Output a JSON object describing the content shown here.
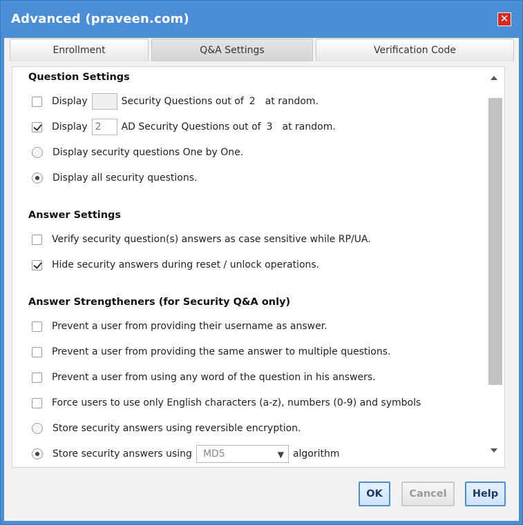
{
  "dialog": {
    "title": "Advanced (praveen.com)",
    "close_glyph": "✕"
  },
  "tabs": [
    {
      "label": "Enrollment",
      "active": false
    },
    {
      "label": "Q&A Settings",
      "active": true
    },
    {
      "label": "Verification Code",
      "active": false
    }
  ],
  "question_settings": {
    "title": "Question Settings",
    "row1": {
      "checked": false,
      "pre": "Display",
      "value": "",
      "mid": "Security Questions out of",
      "count": "2",
      "post": "at random."
    },
    "row2": {
      "checked": true,
      "pre": "Display",
      "value": "2",
      "mid": "AD Security Questions out of",
      "count": "3",
      "post": "at random."
    },
    "radio_one_by_one": {
      "label": "Display security questions One by One.",
      "checked": false
    },
    "radio_all": {
      "label": "Display all security questions.",
      "checked": true
    }
  },
  "answer_settings": {
    "title": "Answer Settings",
    "case_sensitive": {
      "label": "Verify security question(s) answers as case sensitive while RP/UA.",
      "checked": false
    },
    "hide_answers": {
      "label": "Hide security answers during reset / unlock operations.",
      "checked": true
    }
  },
  "answer_strengtheners": {
    "title": "Answer Strengtheners (for Security Q&A only)",
    "no_username": {
      "label": "Prevent a user from providing their username as answer.",
      "checked": false
    },
    "no_same_answer": {
      "label": "Prevent a user from providing the same answer to multiple questions.",
      "checked": false
    },
    "no_question_word": {
      "label": "Prevent a user from using any word of the question in his answers.",
      "checked": false
    },
    "english_only": {
      "label": "Force users to use only English characters (a-z), numbers (0-9) and symbols",
      "checked": false
    },
    "reversible": {
      "label": "Store security answers using reversible encryption.",
      "checked": false
    },
    "algorithm": {
      "pre": "Store security answers using",
      "selected": "MD5",
      "post": "algorithm",
      "checked": true
    }
  },
  "buttons": {
    "ok": "OK",
    "cancel": "Cancel",
    "help": "Help"
  },
  "colors": {
    "title_bar": "#4a8fd6",
    "close": "#d9281f",
    "primary_border": "#4a8fd6"
  }
}
